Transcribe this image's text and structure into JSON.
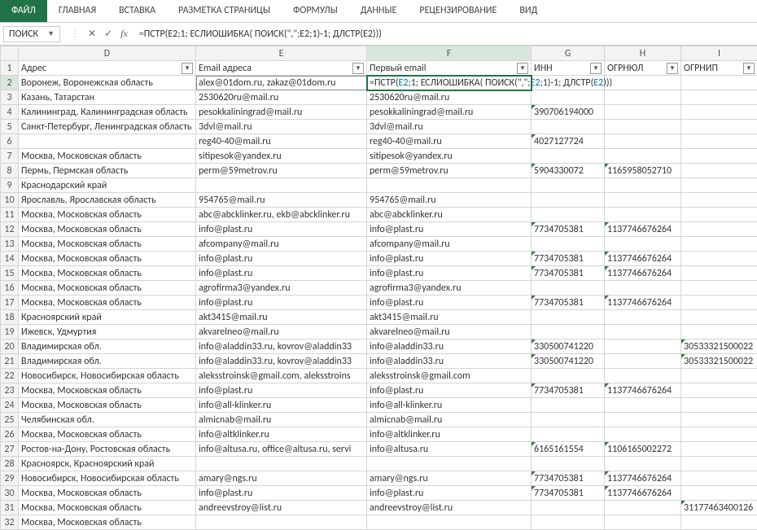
{
  "ribbon": {
    "file": "ФАЙЛ",
    "tabs": [
      "ГЛАВНАЯ",
      "ВСТАВКА",
      "РАЗМЕТКА СТРАНИЦЫ",
      "ФОРМУЛЫ",
      "ДАННЫЕ",
      "РЕЦЕНЗИРОВАНИЕ",
      "ВИД"
    ]
  },
  "formula_bar": {
    "name_box": "ПОИСК",
    "cancel": "✕",
    "enter": "✓",
    "fx": "fx",
    "formula": "=ПСТР(E2;1; ЕСЛИОШИБКА( ПОИСК(\",\";E2;1)-1; ДЛСТР(E2)))"
  },
  "columns": [
    "D",
    "E",
    "F",
    "G",
    "H",
    "I"
  ],
  "headers": {
    "D": "Адрес",
    "E": "Email адреса",
    "F": "Первый email",
    "G": "ИНН",
    "H": "ОГРНЮЛ",
    "I": "ОГРНИП"
  },
  "active_cell": {
    "row": 2,
    "col": "F",
    "display_parts": [
      "=ПСТР(",
      "E2",
      ";1; ЕСЛИОШИБКА( ПОИСК(\",\";",
      "E2",
      ";1)-1; ДЛСТР(",
      "E2",
      ")))"
    ]
  },
  "row_count": 32,
  "rows": [
    {
      "n": 2,
      "D": "Воронеж, Воронежская область",
      "E": "alex@01dom.ru, zakaz@01dom.ru",
      "F": "__FORMULA__",
      "G": "",
      "H": "",
      "I": ""
    },
    {
      "n": 3,
      "D": "Казань, Татарстан",
      "E": "2530620ru@mail.ru",
      "F": "2530620ru@mail.ru",
      "G": "",
      "H": "",
      "I": ""
    },
    {
      "n": 4,
      "D": "Калининград, Калининградская область",
      "E": "pesokkaliningrad@mail.ru",
      "F": "pesokkaliningrad@mail.ru",
      "G": "390706194000",
      "H": "",
      "I": "",
      "triG": true
    },
    {
      "n": 5,
      "D": "Санкт-Петербург, Ленинградская область",
      "E": "3dvl@mail.ru",
      "F": "3dvl@mail.ru",
      "G": "",
      "H": "",
      "I": ""
    },
    {
      "n": 6,
      "D": "",
      "E": "reg40-40@mail.ru",
      "F": "reg40-40@mail.ru",
      "G": "4027127724",
      "H": "",
      "I": "",
      "triG": true
    },
    {
      "n": 7,
      "D": "Москва, Московская область",
      "E": "sitipesok@yandex.ru",
      "F": "sitipesok@yandex.ru",
      "G": "",
      "H": "",
      "I": ""
    },
    {
      "n": 8,
      "D": "Пермь, Пермская область",
      "E": "perm@59metrov.ru",
      "F": "perm@59metrov.ru",
      "G": "5904330072",
      "H": "1165958052710",
      "I": "",
      "triG": true,
      "triH": true
    },
    {
      "n": 9,
      "D": "Краснодарский край",
      "E": "",
      "F": "",
      "G": "",
      "H": "",
      "I": ""
    },
    {
      "n": 10,
      "D": "Ярославль, Ярославская область",
      "E": "954765@mail.ru",
      "F": "954765@mail.ru",
      "G": "",
      "H": "",
      "I": ""
    },
    {
      "n": 11,
      "D": "Москва, Московская область",
      "E": "abc@abcklinker.ru, ekb@abcklinker.ru",
      "F": "abc@abcklinker.ru",
      "G": "",
      "H": "",
      "I": ""
    },
    {
      "n": 12,
      "D": "Москва, Московская область",
      "E": "info@plast.ru",
      "F": "info@plast.ru",
      "G": "7734705381",
      "H": "1137746676264",
      "I": "",
      "triG": true,
      "triH": true
    },
    {
      "n": 13,
      "D": "Москва, Московская область",
      "E": "afcompany@mail.ru",
      "F": "afcompany@mail.ru",
      "G": "",
      "H": "",
      "I": ""
    },
    {
      "n": 14,
      "D": "Москва, Московская область",
      "E": "info@plast.ru",
      "F": "info@plast.ru",
      "G": "7734705381",
      "H": "1137746676264",
      "I": "",
      "triG": true,
      "triH": true
    },
    {
      "n": 15,
      "D": "Москва, Московская область",
      "E": "info@plast.ru",
      "F": "info@plast.ru",
      "G": "7734705381",
      "H": "1137746676264",
      "I": "",
      "triG": true,
      "triH": true
    },
    {
      "n": 16,
      "D": "Москва, Московская область",
      "E": "agrofirma3@yandex.ru",
      "F": "agrofirma3@yandex.ru",
      "G": "",
      "H": "",
      "I": ""
    },
    {
      "n": 17,
      "D": "Москва, Московская область",
      "E": "info@plast.ru",
      "F": "info@plast.ru",
      "G": "7734705381",
      "H": "1137746676264",
      "I": "",
      "triG": true,
      "triH": true
    },
    {
      "n": 18,
      "D": "Красноярский край",
      "E": "akt3415@mail.ru",
      "F": "akt3415@mail.ru",
      "G": "",
      "H": "",
      "I": ""
    },
    {
      "n": 19,
      "D": "Ижевск, Удмуртия",
      "E": "akvarelneo@mail.ru",
      "F": "akvarelneo@mail.ru",
      "G": "",
      "H": "",
      "I": ""
    },
    {
      "n": 20,
      "D": "Владимирская обл.",
      "E": "info@aladdin33.ru, kovrov@aladdin33",
      "F": "info@aladdin33.ru",
      "G": "330500741220",
      "H": "",
      "I": "30533321500022",
      "triG": true,
      "triI": true
    },
    {
      "n": 21,
      "D": "Владимирская обл.",
      "E": "info@aladdin33.ru, kovrov@aladdin33",
      "F": "info@aladdin33.ru",
      "G": "330500741220",
      "H": "",
      "I": "30533321500022",
      "triG": true,
      "triI": true
    },
    {
      "n": 22,
      "D": "Новосибирск, Новосибирская область",
      "E": "aleksstroinsk@gmail.com, aleksstroins",
      "F": "aleksstroinsk@gmail.com",
      "G": "",
      "H": "",
      "I": ""
    },
    {
      "n": 23,
      "D": "Москва, Московская область",
      "E": "info@plast.ru",
      "F": "info@plast.ru",
      "G": "7734705381",
      "H": "1137746676264",
      "I": "",
      "triG": true,
      "triH": true
    },
    {
      "n": 24,
      "D": "Москва, Московская область",
      "E": "info@all-klinker.ru",
      "F": "info@all-klinker.ru",
      "G": "",
      "H": "",
      "I": ""
    },
    {
      "n": 25,
      "D": "Челябинская обл.",
      "E": "almicnab@mail.ru",
      "F": "almicnab@mail.ru",
      "G": "",
      "H": "",
      "I": ""
    },
    {
      "n": 26,
      "D": "Москва, Московская область",
      "E": "info@altklinker.ru",
      "F": "info@altklinker.ru",
      "G": "",
      "H": "",
      "I": ""
    },
    {
      "n": 27,
      "D": "Ростов-на-Дону, Ростовская область",
      "E": "info@altusa.ru, office@altusa.ru, servi",
      "F": "info@altusa.ru",
      "G": "6165161554",
      "H": "1106165002272",
      "I": "",
      "triG": true,
      "triH": true
    },
    {
      "n": 28,
      "D": "Красноярск, Красноярский край",
      "E": "",
      "F": "",
      "G": "",
      "H": "",
      "I": ""
    },
    {
      "n": 29,
      "D": "Новосибирск, Новосибирская область",
      "E": "amary@ngs.ru",
      "F": "amary@ngs.ru",
      "G": "7734705381",
      "H": "1137746676264",
      "I": "",
      "triG": true,
      "triH": true
    },
    {
      "n": 30,
      "D": "Москва, Московская область",
      "E": "info@plast.ru",
      "F": "info@plast.ru",
      "G": "7734705381",
      "H": "1137746676264",
      "I": "",
      "triG": true,
      "triH": true
    },
    {
      "n": 31,
      "D": "Москва, Московская область",
      "E": "andreevstroy@list.ru",
      "F": "andreevstroy@list.ru",
      "G": "",
      "H": "",
      "I": "31177463400126",
      "triI": true
    },
    {
      "n": 32,
      "D": "Москва, Московская область",
      "E": "",
      "F": "",
      "G": "",
      "H": "",
      "I": ""
    }
  ]
}
